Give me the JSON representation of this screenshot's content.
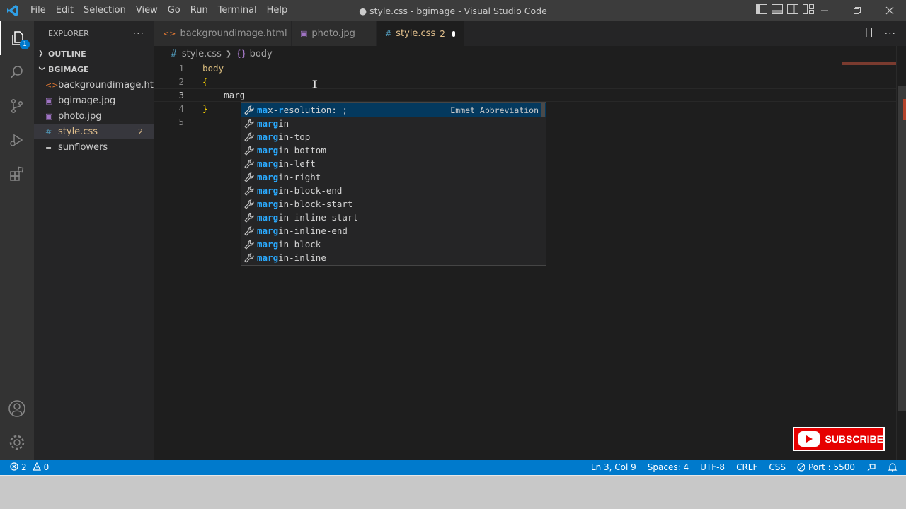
{
  "titlebar": {
    "menu": [
      "File",
      "Edit",
      "Selection",
      "View",
      "Go",
      "Run",
      "Terminal",
      "Help"
    ],
    "title": "● style.css - bgimage - Visual Studio Code"
  },
  "activity": {
    "explorer_badge": "1",
    "icons": [
      "explorer-icon",
      "search-icon",
      "source-control-icon",
      "run-debug-icon",
      "extensions-icon",
      "account-icon",
      "settings-gear-icon"
    ]
  },
  "sidebar": {
    "header": "EXPLORER",
    "more": "···",
    "outline_label": "OUTLINE",
    "folder_label": "BGIMAGE",
    "files": [
      {
        "icon": "<>",
        "label": "backgroundimage.html",
        "count": ""
      },
      {
        "icon": "▣",
        "label": "bgimage.jpg",
        "count": ""
      },
      {
        "icon": "▣",
        "label": "photo.jpg",
        "count": ""
      },
      {
        "icon": "#",
        "label": "style.css",
        "count": "2"
      },
      {
        "icon": "≡",
        "label": "sunflowers",
        "count": ""
      }
    ]
  },
  "tabs": [
    {
      "icon": "<>",
      "label": "backgroundimage.html"
    },
    {
      "icon": "▣",
      "label": "photo.jpg"
    },
    {
      "icon": "#",
      "label": "style.css",
      "count": "2"
    }
  ],
  "breadcrumb": {
    "file": "style.css",
    "symbol": "body"
  },
  "code": {
    "line_numbers": [
      "1",
      "2",
      "3",
      "4",
      "5"
    ],
    "lines": [
      "body",
      "{",
      "    marg",
      "}",
      ""
    ]
  },
  "suggest": {
    "detail": "Emmet Abbreviation",
    "items": [
      {
        "hl": "ma",
        "mid": "x-",
        "hl2": "r",
        "rest": "esolution: ;"
      },
      {
        "hl": "marg",
        "rest": "in"
      },
      {
        "hl": "marg",
        "rest": "in-top"
      },
      {
        "hl": "marg",
        "rest": "in-bottom"
      },
      {
        "hl": "marg",
        "rest": "in-left"
      },
      {
        "hl": "marg",
        "rest": "in-right"
      },
      {
        "hl": "marg",
        "rest": "in-block-end"
      },
      {
        "hl": "marg",
        "rest": "in-block-start"
      },
      {
        "hl": "marg",
        "rest": "in-inline-start"
      },
      {
        "hl": "marg",
        "rest": "in-inline-end"
      },
      {
        "hl": "marg",
        "rest": "in-block"
      },
      {
        "hl": "marg",
        "rest": "in-inline"
      }
    ]
  },
  "statusbar": {
    "errors": "2",
    "warnings": "0",
    "position": "Ln 3, Col 9",
    "spaces": "Spaces: 4",
    "encoding": "UTF-8",
    "eol": "CRLF",
    "language": "CSS",
    "port": "Port : 5500"
  },
  "overlay": {
    "subscribe": "SUBSCRIBE"
  },
  "colors": {
    "accent": "#007acc",
    "modified": "#e2c08d",
    "highlight": "#2aaaff"
  }
}
